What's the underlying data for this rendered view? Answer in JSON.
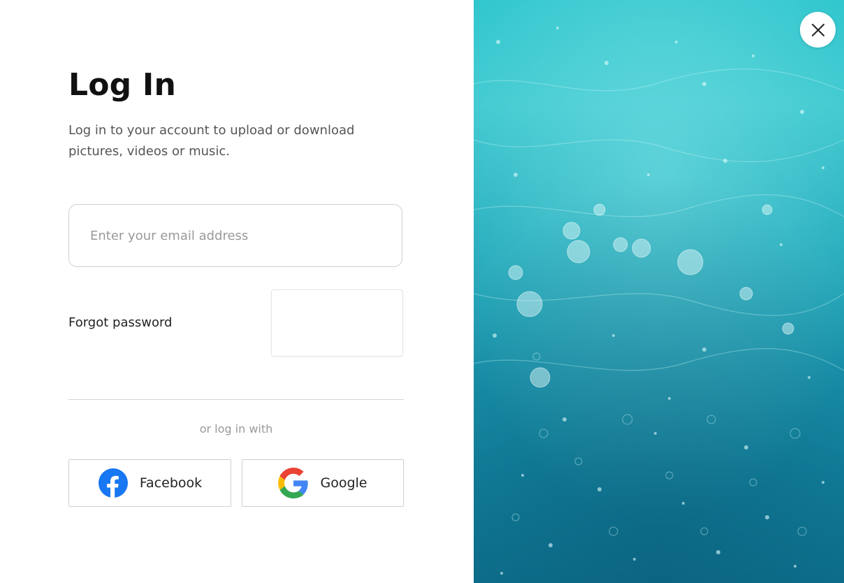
{
  "login": {
    "title": "Log In",
    "subtitle": "Log in to your account to upload or download pictures, videos or music.",
    "email_placeholder": "Enter your email address",
    "email_value": "",
    "forgot_password": "Forgot password",
    "divider_text": "or log in with",
    "facebook_label": "Facebook",
    "google_label": "Google"
  },
  "icons": {
    "close": "close-icon",
    "facebook": "facebook-icon",
    "google": "google-icon"
  },
  "colors": {
    "facebook_blue": "#1877F2",
    "google_blue": "#4285F4",
    "google_red": "#EA4335",
    "google_yellow": "#FBBC05",
    "google_green": "#34A853",
    "water_top": "#2fc6cd",
    "water_bottom": "#0d6f8c"
  }
}
